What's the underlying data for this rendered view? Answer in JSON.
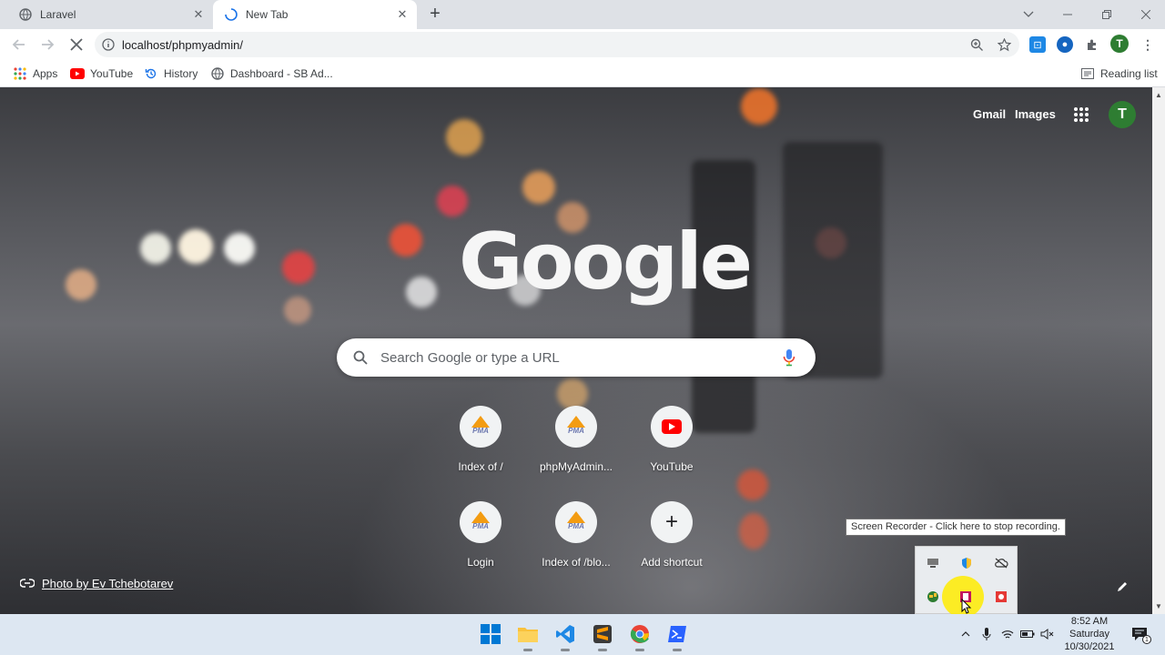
{
  "tabs": [
    {
      "title": "Laravel",
      "close": "✕"
    },
    {
      "title": "New Tab",
      "close": "✕"
    }
  ],
  "new_tab_symbol": "+",
  "address_bar": {
    "url": "localhost/phpmyadmin/"
  },
  "bookmarks": {
    "items": [
      {
        "label": "Apps",
        "icon": "apps-grid-icon"
      },
      {
        "label": "YouTube",
        "icon": "youtube-icon"
      },
      {
        "label": "History",
        "icon": "history-icon"
      },
      {
        "label": "Dashboard - SB Ad..."
      }
    ],
    "reading_list": "Reading list"
  },
  "profile_initial": "T",
  "top_links": {
    "gmail": "Gmail",
    "images": "Images"
  },
  "logo_text": "Google",
  "search": {
    "placeholder": "Search Google or type a URL"
  },
  "shortcuts": [
    {
      "label": "Index of /",
      "icon": "pma"
    },
    {
      "label": "phpMyAdmin...",
      "icon": "pma"
    },
    {
      "label": "YouTube",
      "icon": "youtube"
    },
    {
      "label": "Login",
      "icon": "pma"
    },
    {
      "label": "Index of /blo...",
      "icon": "pma"
    },
    {
      "label": "Add shortcut",
      "icon": "plus"
    }
  ],
  "pma_text": "PMA",
  "photo_credit": "Photo by Ev Tchebotarev",
  "tooltip": "Screen Recorder - Click here to stop recording.",
  "clock": {
    "time": "8:52 AM",
    "day": "Saturday",
    "date": "10/30/2021"
  },
  "notification_count": "1",
  "colors": {
    "tab_bar": "#dee1e6",
    "taskbar": "#dde7f2",
    "accent_green": "#2e7d32",
    "highlight": "#ffec00"
  }
}
